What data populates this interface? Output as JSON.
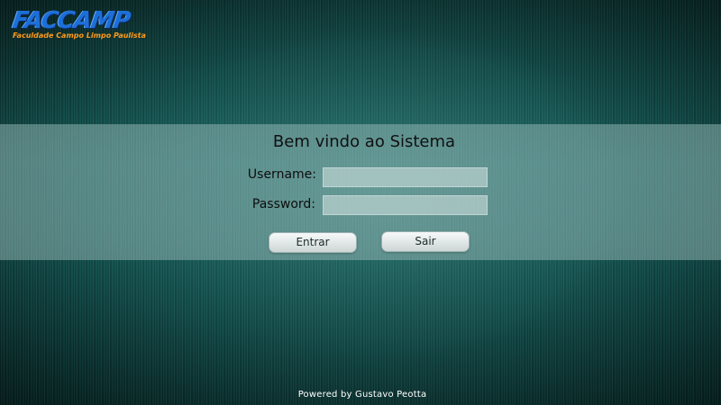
{
  "branding": {
    "logo_text": "FACCAMP",
    "logo_subtitle": "Faculdade Campo Limpo Paulista"
  },
  "login": {
    "title": "Bem vindo ao Sistema",
    "username_label": "Username:",
    "username_value": "",
    "password_label": "Password:",
    "password_value": "",
    "enter_label": "Entrar",
    "exit_label": "Sair"
  },
  "footer": {
    "credit": "Powered by Gustavo Peotta"
  },
  "colors": {
    "background": "#135855",
    "band": "#96b9b6",
    "logo_blue": "#1d6fd8",
    "logo_orange": "#ff9a1c"
  }
}
